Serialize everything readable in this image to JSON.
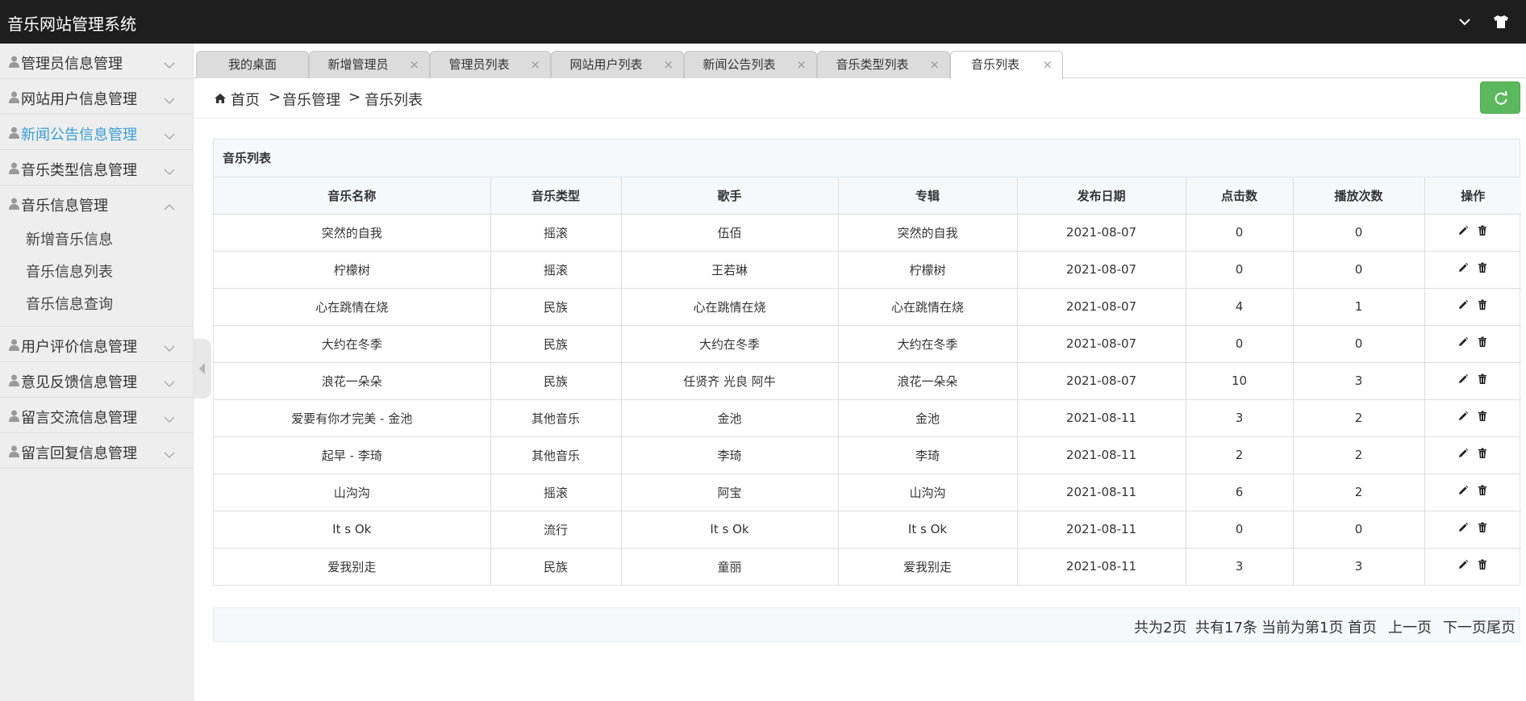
{
  "app_title": "音乐网站管理系统",
  "topbar_icons": [
    "chevron-down-icon",
    "shirt-icon"
  ],
  "sidebar": {
    "items": [
      {
        "label": "管理员信息管理",
        "state": "collapsed"
      },
      {
        "label": "网站用户信息管理",
        "state": "collapsed"
      },
      {
        "label": "新闻公告信息管理",
        "state": "collapsed",
        "highlight": "#3a9fd6"
      },
      {
        "label": "音乐类型信息管理",
        "state": "collapsed"
      },
      {
        "label": "音乐信息管理",
        "state": "expanded",
        "children": [
          "新增音乐信息",
          "音乐信息列表",
          "音乐信息查询"
        ]
      },
      {
        "label": "用户评价信息管理",
        "state": "collapsed"
      },
      {
        "label": "意见反馈信息管理",
        "state": "collapsed"
      },
      {
        "label": "留言交流信息管理",
        "state": "collapsed"
      },
      {
        "label": "留言回复信息管理",
        "state": "collapsed"
      }
    ]
  },
  "tabs": [
    {
      "label": "我的桌面",
      "closable": false
    },
    {
      "label": "新增管理员",
      "closable": true
    },
    {
      "label": "管理员列表",
      "closable": true
    },
    {
      "label": "网站用户列表",
      "closable": true
    },
    {
      "label": "新闻公告列表",
      "closable": true
    },
    {
      "label": "音乐类型列表",
      "closable": true
    },
    {
      "label": "音乐列表",
      "closable": true,
      "active": true
    }
  ],
  "tab_close_glyph": "×",
  "breadcrumb": {
    "items": [
      "首页",
      "音乐管理",
      "音乐列表"
    ],
    "separator": ">"
  },
  "refresh_color": "#5cb85c",
  "panel": {
    "title": "音乐列表",
    "columns": [
      "音乐名称",
      "音乐类型",
      "歌手",
      "专辑",
      "发布日期",
      "点击数",
      "播放次数",
      "操作"
    ],
    "rows": [
      [
        "突然的自我",
        "摇滚",
        "伍佰",
        "突然的自我",
        "2021-08-07",
        "0",
        "0"
      ],
      [
        "柠檬树",
        "摇滚",
        "王若琳",
        "柠檬树",
        "2021-08-07",
        "0",
        "0"
      ],
      [
        "心在跳情在烧",
        "民族",
        "心在跳情在烧",
        "心在跳情在烧",
        "2021-08-07",
        "4",
        "1"
      ],
      [
        "大约在冬季",
        "民族",
        "大约在冬季",
        "大约在冬季",
        "2021-08-07",
        "0",
        "0"
      ],
      [
        "浪花一朵朵",
        "民族",
        "任贤齐 光良 阿牛",
        "浪花一朵朵",
        "2021-08-07",
        "10",
        "3"
      ],
      [
        "爱要有你才完美 - 金池",
        "其他音乐",
        "金池",
        "金池",
        "2021-08-11",
        "3",
        "2"
      ],
      [
        "起早 - 李琦",
        "其他音乐",
        "李琦",
        "李琦",
        "2021-08-11",
        "2",
        "2"
      ],
      [
        "山沟沟",
        "摇滚",
        "阿宝",
        "山沟沟",
        "2021-08-11",
        "6",
        "2"
      ],
      [
        "It s Ok",
        "流行",
        "It s Ok",
        "It s Ok",
        "2021-08-11",
        "0",
        "0"
      ],
      [
        "爱我别走",
        "民族",
        "童丽",
        "爱我别走",
        "2021-08-11",
        "3",
        "3"
      ]
    ],
    "row_actions": [
      "edit-icon",
      "delete-icon"
    ]
  },
  "pagination": {
    "total_pages": "共为2页",
    "total_records": "共有17条",
    "current_page": "当前为第1页",
    "first": "首页",
    "prev": "上一页",
    "next": "下一页",
    "last": "尾页"
  }
}
